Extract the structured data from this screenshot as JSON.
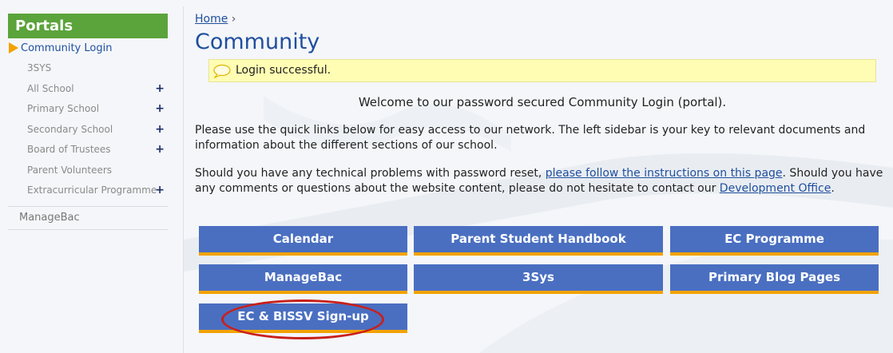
{
  "sidebar": {
    "header": "Portals",
    "active_item": "Community Login",
    "sub_items": [
      {
        "label": "3SYS",
        "plus": ""
      },
      {
        "label": "All School",
        "plus": "+"
      },
      {
        "label": "Primary School",
        "plus": "+"
      },
      {
        "label": "Secondary School",
        "plus": "+"
      },
      {
        "label": "Board of Trustees",
        "plus": "+"
      },
      {
        "label": "Parent Volunteers",
        "plus": ""
      },
      {
        "label": "Extracurricular Programme",
        "plus": "+"
      }
    ],
    "bottom_item": "ManageBac"
  },
  "breadcrumb": {
    "home": "Home",
    "separator": "›"
  },
  "page_title": "Community",
  "notice": {
    "text": "Login successful."
  },
  "welcome": "Welcome to our password secured Community Login (portal).",
  "paragraph1": "Please use the quick links below for easy access to our network. The left sidebar is your key to relevant documents and information about the different sections of our school.",
  "paragraph2": {
    "before_link": "Should you have any technical problems with password reset, ",
    "link1": "please follow the instructions on this page",
    "middle": ". Should you have any comments or questions about the website content, please do not hesitate to contact our ",
    "link2": "Development Office",
    "after": "."
  },
  "quick_links": [
    "Calendar",
    "Parent Student Handbook",
    "EC Programme",
    "ManageBac",
    "3Sys",
    "Primary Blog Pages",
    "EC & BISSV Sign-up"
  ],
  "colors": {
    "header_green": "#5ba33b",
    "link_blue": "#1f4f9e",
    "button_blue": "#4a6fc1",
    "button_accent": "#f2a200",
    "notice_bg": "#fffdb3",
    "highlight_circle": "#c8201b"
  }
}
